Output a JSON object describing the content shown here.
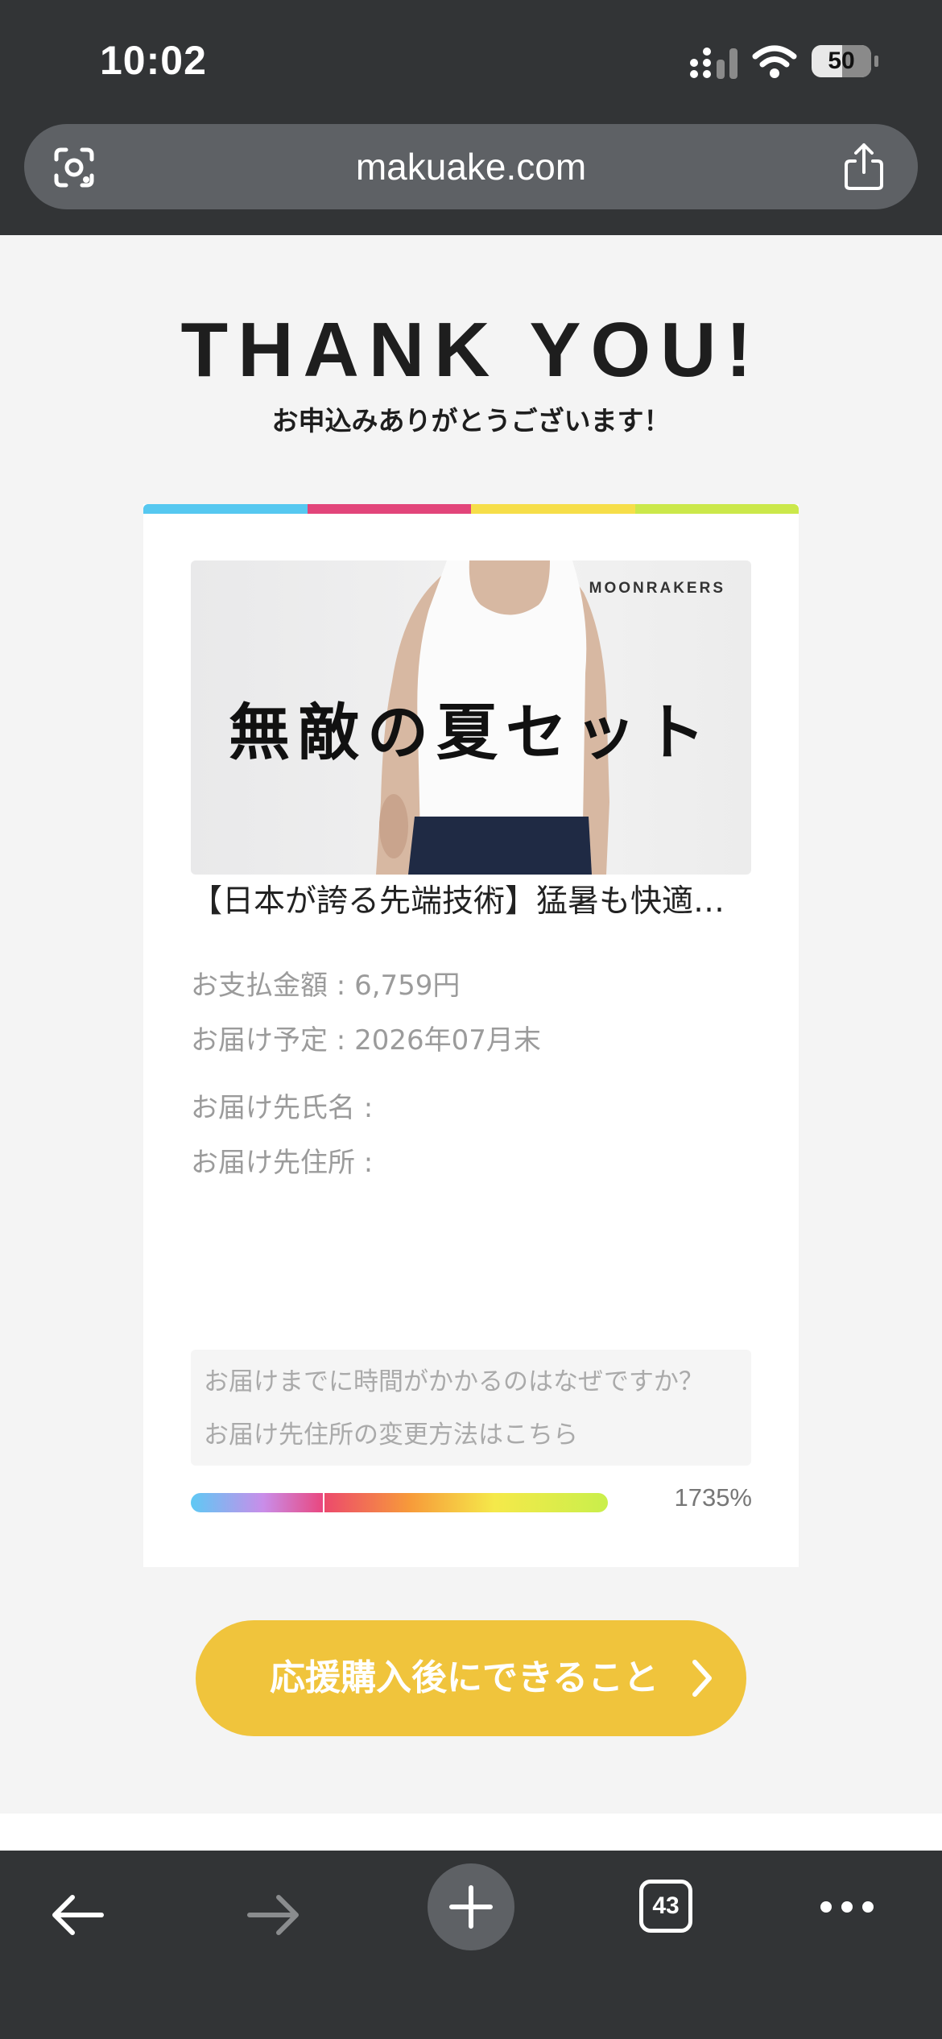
{
  "status": {
    "time": "10:02",
    "battery": "50"
  },
  "browser": {
    "url": "makuake.com",
    "tab_count": "43"
  },
  "header": {
    "title": "THANK YOU!",
    "subtitle": "お申込みありがとうございます！"
  },
  "colors": {
    "stripe": [
      "#56c8f0",
      "#e2457a",
      "#f6de49",
      "#cbe84a"
    ],
    "cta": "#f0c43c"
  },
  "card": {
    "banner": {
      "brand": "MOONRAKERS",
      "title": "無敵の夏セット"
    },
    "project_title": "【日本が誇る先端技術】猛暑も快適に過ごせる無敵の夏セット",
    "payment": "お支払金額 : 6,759円",
    "delivery_schedule": "お届け予定 : 2026年07月末",
    "recipient_name": "お届け先氏名 :",
    "recipient_address": "お届け先住所 :",
    "faq_links": [
      "お届けまでに時間がかかるのはなぜですか？",
      "お届け先住所の変更方法はこちら"
    ],
    "progress_percent": "1735%"
  },
  "cta": {
    "label": "応援購入後にできること"
  }
}
